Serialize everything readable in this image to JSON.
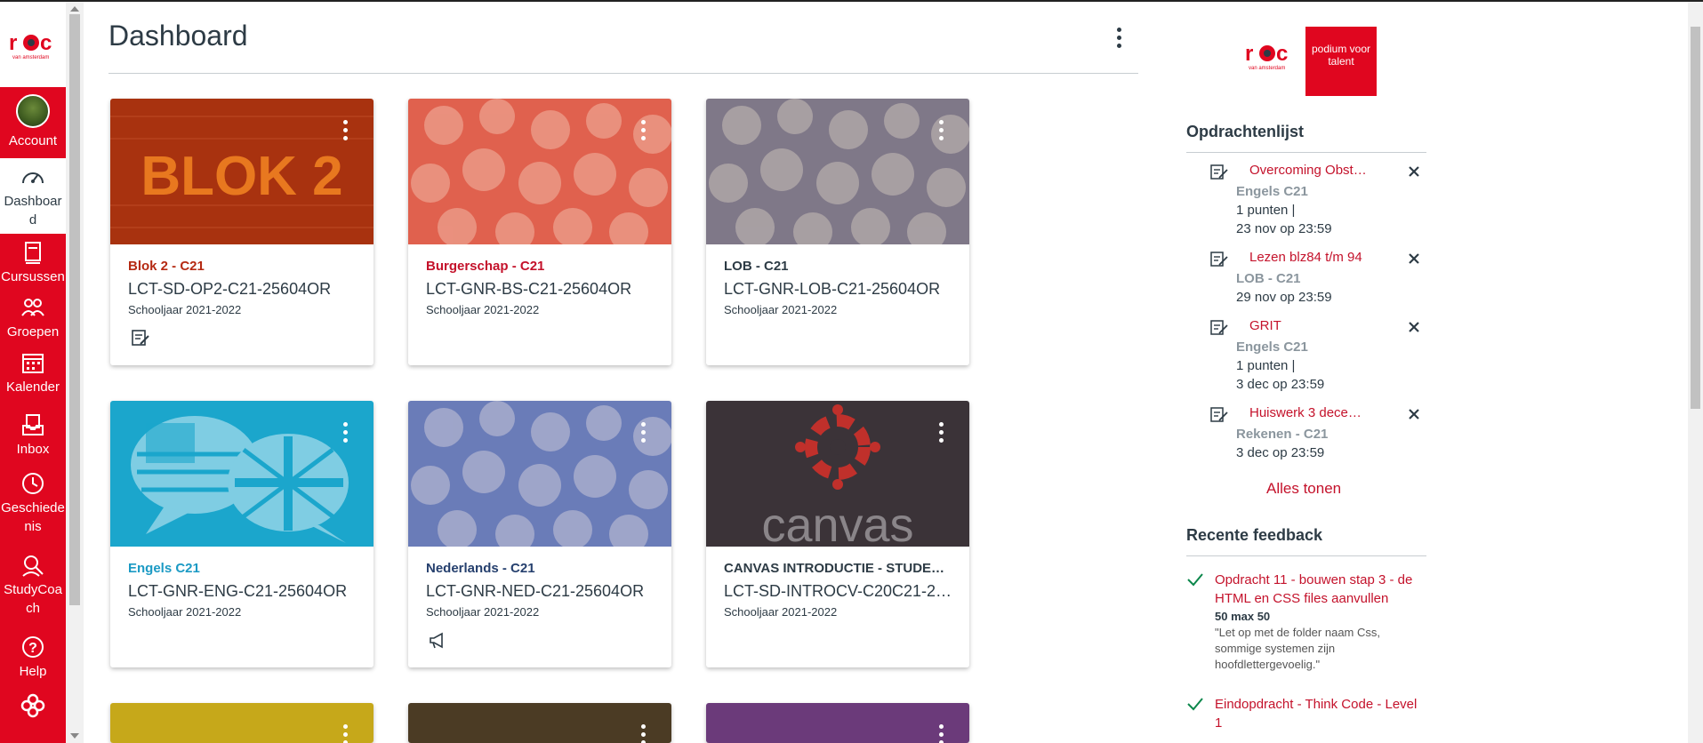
{
  "nav": {
    "logo_text": "roc",
    "logo_sub": "van amsterdam",
    "items": [
      {
        "label": "Account",
        "icon": "avatar"
      },
      {
        "label": "Dashboard",
        "icon": "dashboard-icon"
      },
      {
        "label": "Cursussen",
        "icon": "courses-icon"
      },
      {
        "label": "Groepen",
        "icon": "groups-icon"
      },
      {
        "label": "Kalender",
        "icon": "calendar-icon"
      },
      {
        "label": "Inbox",
        "icon": "inbox-icon"
      },
      {
        "label": "Geschiedenis",
        "icon": "history-icon"
      },
      {
        "label": "StudyCoach",
        "icon": "studycoach-icon"
      },
      {
        "label": "Help",
        "icon": "help-icon"
      }
    ]
  },
  "page": {
    "title": "Dashboard"
  },
  "cards": [
    {
      "name": "Blok 2 - C21",
      "code": "LCT-SD-OP2-C21-25604OR",
      "term": "Schooljaar 2021-2022",
      "color": "#b52a13",
      "hero_text": "BLOK 2",
      "hero_color": "#c23e12",
      "icon": "assignment-icon"
    },
    {
      "name": "Burgerschap - C21",
      "code": "LCT-GNR-BS-C21-25604OR",
      "term": "Schooljaar 2021-2022",
      "color": "#c4122b",
      "hero_color": "#e0614e",
      "icon": ""
    },
    {
      "name": "LOB - C21",
      "code": "LCT-GNR-LOB-C21-25604OR",
      "term": "Schooljaar 2021-2022",
      "color": "#2d3b45",
      "hero_color": "#8a8494",
      "icon": ""
    },
    {
      "name": "Engels C21",
      "code": "LCT-GNR-ENG-C21-25604OR",
      "term": "Schooljaar 2021-2022",
      "color": "#1b9ac4",
      "hero_color": "#1ba6cc",
      "icon": ""
    },
    {
      "name": "Nederlands - C21",
      "code": "LCT-GNR-NED-C21-25604OR",
      "term": "Schooljaar 2021-2022",
      "color": "#26406e",
      "hero_color": "#6a7cb8",
      "icon": "announcement-icon"
    },
    {
      "name": "CANVAS INTRODUCTIE - STUDE…",
      "code": "LCT-SD-INTROCV-C20C21-2…",
      "term": "Schooljaar 2021-2022",
      "color": "#2d3b45",
      "hero_color": "#3b3338",
      "hero_text": "canvas",
      "icon": ""
    }
  ],
  "sidebar": {
    "badge_text": "podium voor talent",
    "todo_title": "Opdrachtenlijst",
    "todos": [
      {
        "title": "Overcoming Obst…",
        "course": "Engels C21",
        "points": "1 punten  |",
        "due": "23 nov op 23:59"
      },
      {
        "title": "Lezen blz84 t/m 94",
        "course": "LOB - C21",
        "points": "",
        "due": "29 nov op 23:59"
      },
      {
        "title": "GRIT",
        "course": "Engels C21",
        "points": "1 punten  |",
        "due": "3 dec op 23:59"
      },
      {
        "title": "Huiswerk 3 dece…",
        "course": "Rekenen - C21",
        "points": "",
        "due": "3 dec op 23:59"
      }
    ],
    "show_all": "Alles tonen",
    "feedback_title": "Recente feedback",
    "feedback": [
      {
        "title": "Opdracht 11 - bouwen stap 3 - de HTML en CSS files aanvullen",
        "score": "50 max 50",
        "comment": "\"Let op met de folder naam Css, sommige systemen zijn hoofdlettergevoelig.\""
      },
      {
        "title": "Eindopdracht - Think Code - Level 1",
        "score": "",
        "comment": ""
      }
    ]
  }
}
